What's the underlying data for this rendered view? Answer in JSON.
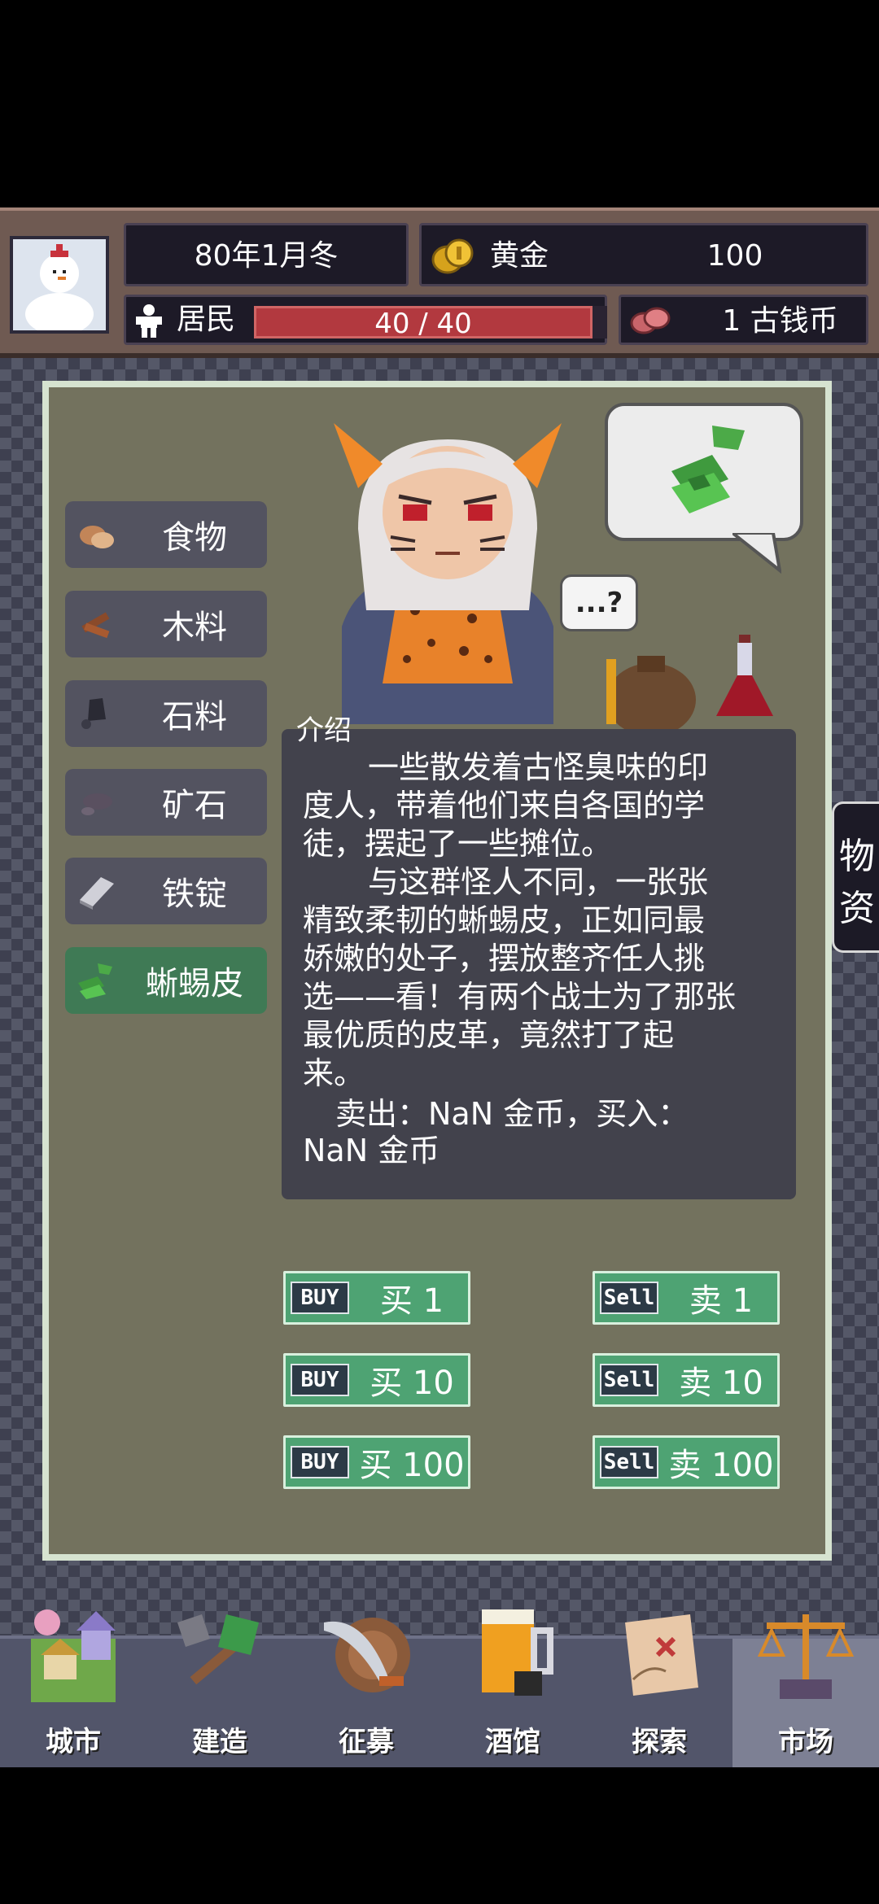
{
  "header": {
    "date": "80年1月冬",
    "gold_label": "黄金",
    "gold_value": "100",
    "residents_label": "居民",
    "residents_value": "40 / 40",
    "residents_fill": 1.0,
    "coin_text": "1 古钱币"
  },
  "categories": [
    {
      "label": "食物",
      "icon": "bread-icon"
    },
    {
      "label": "木料",
      "icon": "wood-icon"
    },
    {
      "label": "石料",
      "icon": "stone-icon"
    },
    {
      "label": "矿石",
      "icon": "ore-icon"
    },
    {
      "label": "铁锭",
      "icon": "iron-ingot-icon"
    },
    {
      "label": "蜥蜴皮",
      "icon": "lizard-skin-icon"
    }
  ],
  "speech": {
    "text": "...?"
  },
  "description": {
    "title": "介绍",
    "lines": [
      "一些散发着古怪臭味的印",
      "度人，带着他们来自各国的学",
      "徒，摆起了一些摊位。",
      "与这群怪人不同，一张张",
      "精致柔韧的蜥蜴皮，正如同最",
      "娇嫩的处子，摆放整齐任人挑",
      "选——看！有两个战士为了那张",
      "最优质的皮革，竟然打了起",
      "来。",
      "卖出：NaN 金币，买入：",
      "NaN 金币"
    ]
  },
  "buttons": {
    "buy_tag": "BUY",
    "sell_tag": "Sell",
    "buy1": "买 1",
    "buy10": "买 10",
    "buy100": "买 100",
    "sell1": "卖 1",
    "sell10": "卖 10",
    "sell100": "卖 100"
  },
  "side_tab": {
    "chars": [
      "物",
      "资"
    ]
  },
  "nav": [
    {
      "label": "城市"
    },
    {
      "label": "建造"
    },
    {
      "label": "征募"
    },
    {
      "label": "酒馆"
    },
    {
      "label": "探索"
    },
    {
      "label": "市场"
    }
  ]
}
